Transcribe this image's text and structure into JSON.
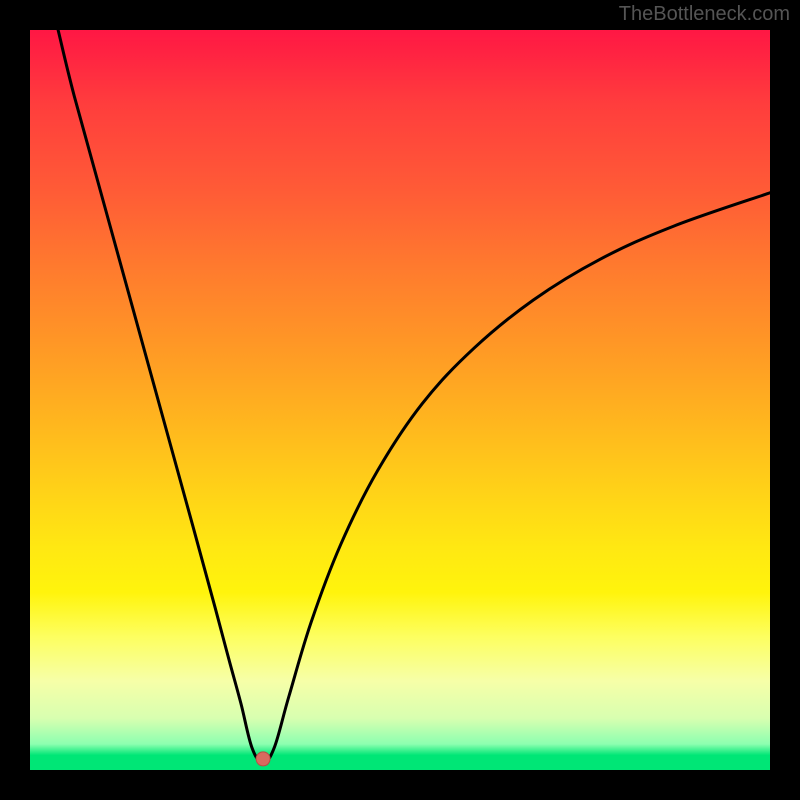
{
  "watermark": "TheBottleneck.com",
  "chart_data": {
    "type": "line",
    "title": "",
    "xlabel": "",
    "ylabel": "",
    "xlim": [
      0,
      100
    ],
    "ylim": [
      0,
      100
    ],
    "series": [
      {
        "name": "curve",
        "x": [
          3.8,
          6,
          10,
          14,
          18,
          22,
          25,
          27,
          28.5,
          30,
          31.5,
          33,
          35,
          38,
          42,
          47,
          53,
          60,
          68,
          77,
          87,
          100
        ],
        "y": [
          100,
          91,
          76.5,
          62,
          47.5,
          33,
          22,
          14.5,
          9,
          3,
          1,
          3,
          10,
          20,
          30.5,
          40.5,
          49.5,
          57,
          63.5,
          69,
          73.5,
          78
        ]
      }
    ],
    "marker": {
      "x": 31.5,
      "y": 1.5,
      "color": "#d96a5f"
    },
    "gradient_stops": [
      {
        "pct": 0,
        "color": "#ff1744"
      },
      {
        "pct": 50,
        "color": "#ffc107"
      },
      {
        "pct": 80,
        "color": "#ffff72"
      },
      {
        "pct": 100,
        "color": "#00e676"
      }
    ]
  }
}
